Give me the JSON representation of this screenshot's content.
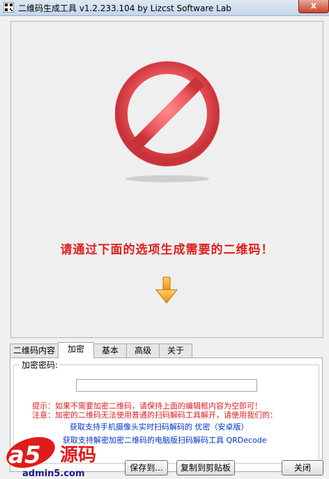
{
  "window": {
    "title": "二维码生成工具 v1.2.233.104   by Lizcst Software Lab",
    "close_label": "x"
  },
  "preview": {
    "instruction": "请通过下面的选项生成需要的二维码！",
    "icons": [
      "prohibited-sign-icon",
      "down-arrow-icon"
    ],
    "colors": {
      "sign": "#e8555a",
      "instruction": "#e01d1d",
      "arrow": "#f5a21b"
    }
  },
  "tabs": [
    {
      "label": "二维码内容",
      "active": false
    },
    {
      "label": "加密",
      "active": true
    },
    {
      "label": "基本",
      "active": false
    },
    {
      "label": "高级",
      "active": false
    },
    {
      "label": "关于",
      "active": false
    }
  ],
  "encrypt": {
    "group_label": "加密密码:",
    "password_value": "",
    "hint": "提示：如果不需要加密二维码，请保持上面的编辑框内容为空即可！",
    "note": "注意：加密的二维码无法使用普通的扫码解码工具解开，请使用我们的：",
    "link_mobile": "获取支持手机摄像头实时扫码解码的 优密（安卓版）",
    "link_desktop": "获取支持解密加密二维码的电脑版扫码解码工具 QRDecode"
  },
  "buttons": {
    "save": "保存到...",
    "copy": "复制到剪贴板",
    "close": "关闭"
  },
  "watermark": {
    "brand": "a5源码",
    "url": "admin5.com"
  }
}
